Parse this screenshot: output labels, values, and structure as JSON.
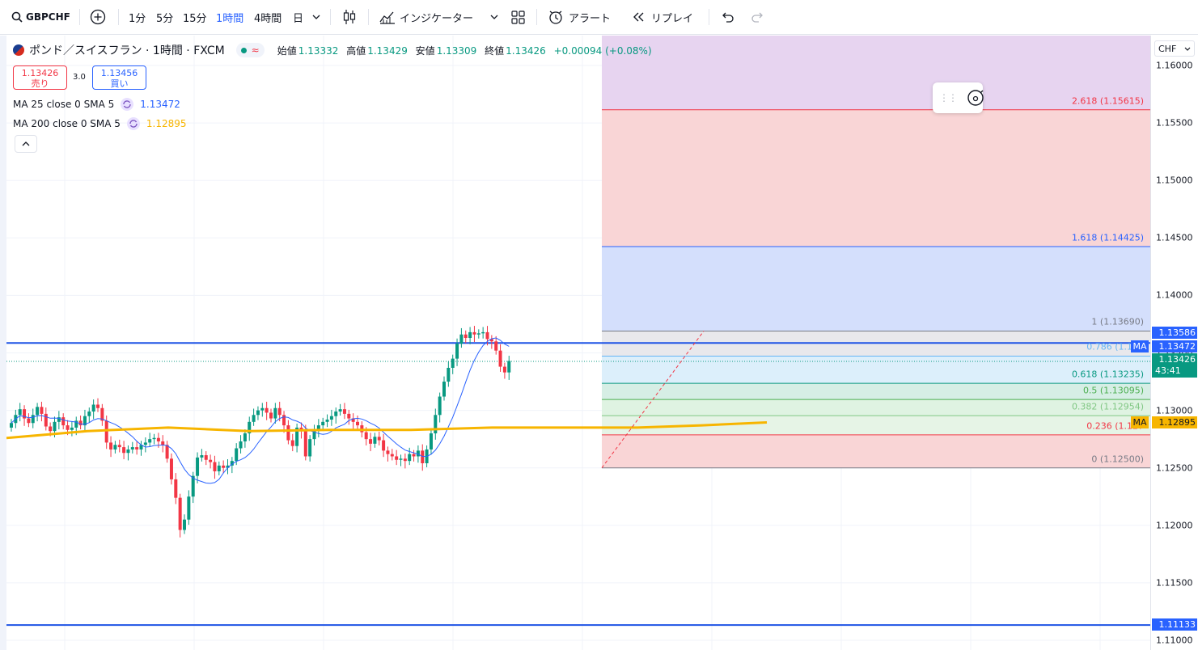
{
  "toolbar": {
    "symbol": "GBPCHF",
    "timeframes": [
      "1分",
      "5分",
      "15分",
      "1時間",
      "4時間",
      "日"
    ],
    "active_timeframe": "1時間",
    "indicators_label": "インジケーター",
    "alert_label": "アラート",
    "replay_label": "リプレイ"
  },
  "legend": {
    "title": "ポンド／スイスフラン · 1時間 · FXCM",
    "open_label": "始値",
    "open": "1.13332",
    "high_label": "高値",
    "high": "1.13429",
    "low_label": "安値",
    "low": "1.13309",
    "close_label": "終値",
    "close": "1.13426",
    "change": "+0.00094 (+0.08%)",
    "sell_price": "1.13426",
    "sell_label": "売り",
    "spread": "3.0",
    "buy_price": "1.13456",
    "buy_label": "買い",
    "ma1": {
      "label": "MA 25 close 0 SMA 5",
      "value": "1.13472",
      "color": "#2962ff"
    },
    "ma2": {
      "label": "MA 200 close 0 SMA 5",
      "value": "1.12895",
      "color": "#f7b500"
    }
  },
  "price_axis": {
    "currency": "CHF",
    "ticks": [
      "1.16000",
      "1.15500",
      "1.15000",
      "1.14500",
      "1.14000",
      "1.13500",
      "1.13000",
      "1.12500",
      "1.12000",
      "1.11500",
      "1.11000"
    ],
    "badges": {
      "upper_line": "1.13586",
      "ma25": "1.13472",
      "ma_tag": "MA",
      "last_price": "1.13426",
      "countdown": "43:41",
      "ma200": "1.12895",
      "lower_line": "1.11133"
    }
  },
  "fib": {
    "levels": [
      {
        "ratio": "2.618",
        "price": "1.15615",
        "label": "2.618 (1.15615)",
        "color": "#f23645"
      },
      {
        "ratio": "1.618",
        "price": "1.14425",
        "label": "1.618 (1.14425)",
        "color": "#2962ff"
      },
      {
        "ratio": "1",
        "price": "1.13690",
        "label": "1 (1.13690)",
        "color": "#787b86"
      },
      {
        "ratio": "0.786",
        "price": "1.13472",
        "label": "0.786 (1.134",
        "color": "#64b5f6"
      },
      {
        "ratio": "0.618",
        "price": "1.13235",
        "label": "0.618 (1.13235)",
        "color": "#089981"
      },
      {
        "ratio": "0.5",
        "price": "1.13095",
        "label": "0.5 (1.13095)",
        "color": "#4caf50"
      },
      {
        "ratio": "0.382",
        "price": "1.12954",
        "label": "0.382 (1.12954)",
        "color": "#81c784"
      },
      {
        "ratio": "0.236",
        "price": "1.12787",
        "label": "0.236 (1.127",
        "color": "#f23645"
      },
      {
        "ratio": "0",
        "price": "1.12500",
        "label": "0 (1.12500)",
        "color": "#787b86"
      }
    ]
  },
  "colors": {
    "up": "#089981",
    "down": "#f23645",
    "accent": "#2962ff",
    "ma200": "#f7b500"
  }
}
